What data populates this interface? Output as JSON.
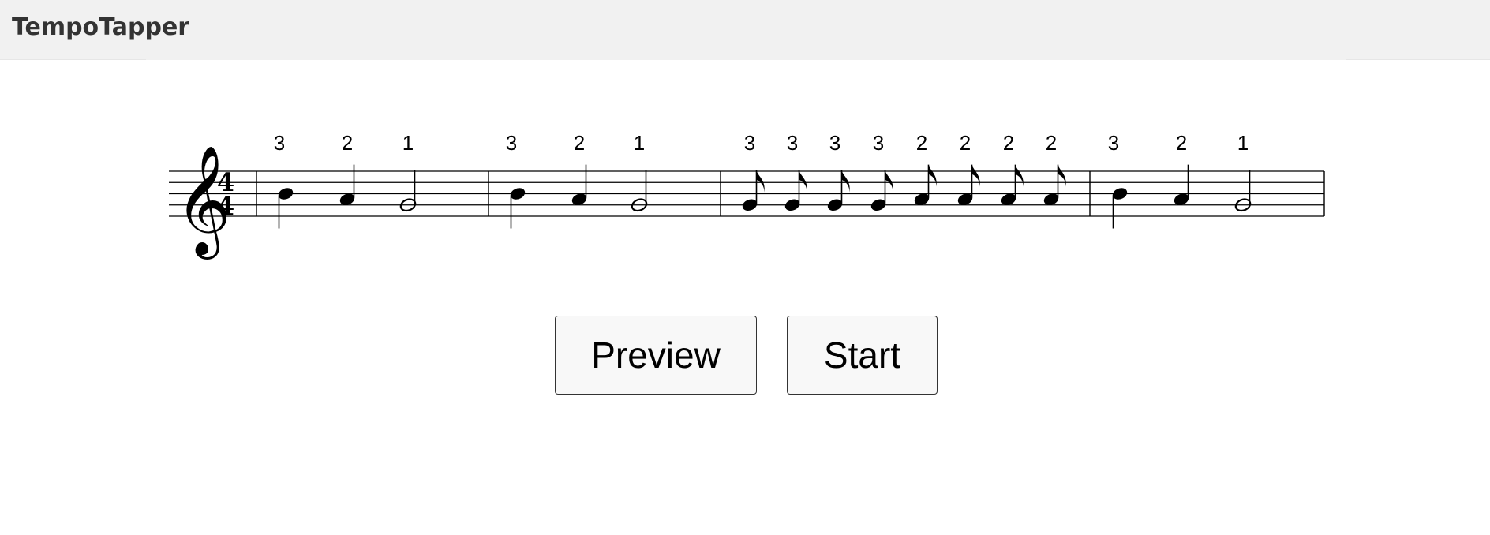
{
  "app": {
    "title": "TempoTapper"
  },
  "score": {
    "clef": "treble-clef",
    "time_signature": {
      "top": "4",
      "bottom": "4"
    },
    "measures": [
      {
        "notes": [
          {
            "type": "quarter",
            "pitch": "B4",
            "stem": "down",
            "finger": "3"
          },
          {
            "type": "quarter",
            "pitch": "A4",
            "stem": "up",
            "finger": "2"
          },
          {
            "type": "half",
            "pitch": "G4",
            "stem": "up",
            "finger": "1"
          }
        ]
      },
      {
        "notes": [
          {
            "type": "quarter",
            "pitch": "B4",
            "stem": "down",
            "finger": "3"
          },
          {
            "type": "quarter",
            "pitch": "A4",
            "stem": "up",
            "finger": "2"
          },
          {
            "type": "half",
            "pitch": "G4",
            "stem": "up",
            "finger": "1"
          }
        ]
      },
      {
        "notes": [
          {
            "type": "eighth",
            "pitch": "G4",
            "stem": "up",
            "finger": "3"
          },
          {
            "type": "eighth",
            "pitch": "G4",
            "stem": "up",
            "finger": "3"
          },
          {
            "type": "eighth",
            "pitch": "G4",
            "stem": "up",
            "finger": "3"
          },
          {
            "type": "eighth",
            "pitch": "G4",
            "stem": "up",
            "finger": "3"
          },
          {
            "type": "eighth",
            "pitch": "A4",
            "stem": "up",
            "finger": "2"
          },
          {
            "type": "eighth",
            "pitch": "A4",
            "stem": "up",
            "finger": "2"
          },
          {
            "type": "eighth",
            "pitch": "A4",
            "stem": "up",
            "finger": "2"
          },
          {
            "type": "eighth",
            "pitch": "A4",
            "stem": "up",
            "finger": "2"
          }
        ]
      },
      {
        "notes": [
          {
            "type": "quarter",
            "pitch": "B4",
            "stem": "down",
            "finger": "3"
          },
          {
            "type": "quarter",
            "pitch": "A4",
            "stem": "up",
            "finger": "2"
          },
          {
            "type": "half",
            "pitch": "G4",
            "stem": "up",
            "finger": "1"
          }
        ]
      }
    ]
  },
  "buttons": {
    "preview_label": "Preview",
    "start_label": "Start"
  }
}
